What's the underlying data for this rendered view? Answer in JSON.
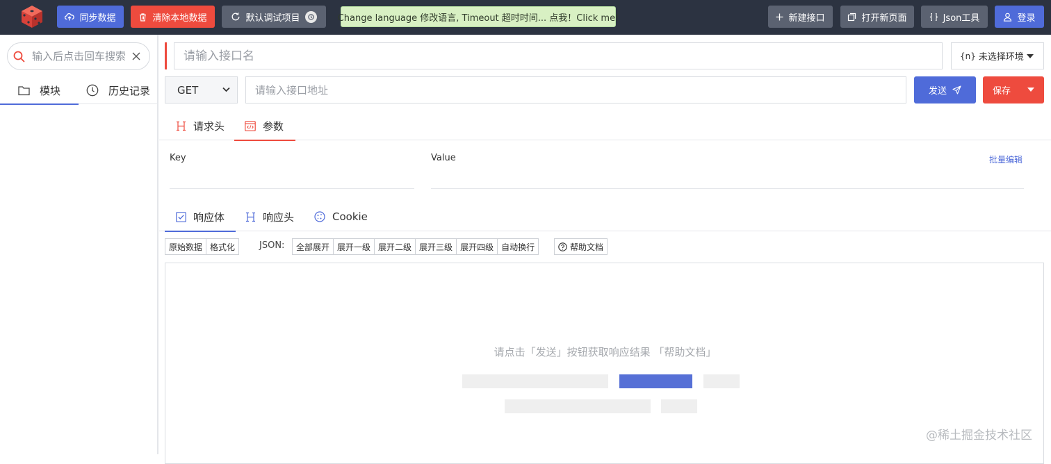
{
  "topbar": {
    "sync_label": "同步数据",
    "clear_label": "清除本地数据",
    "project_label": "默认调试项目",
    "notice": "Change language 修改语言, Timeout 超时时间... 点我！Click me!",
    "new_api_label": "新建接口",
    "open_page_label": "打开新页面",
    "json_tool_label": "Json工具",
    "login_label": "登录"
  },
  "sidebar": {
    "search_placeholder": "输入后点击回车搜索",
    "tabs": [
      {
        "label": "模块",
        "active": true
      },
      {
        "label": "历史记录",
        "active": false
      }
    ]
  },
  "request": {
    "name_placeholder": "请输入接口名",
    "env_label": "未选择环境",
    "env_icon_text": "{n}",
    "method": "GET",
    "url_placeholder": "请输入接口地址",
    "send_label": "发送",
    "save_label": "保存",
    "tabs": [
      {
        "label": "请求头",
        "active": false
      },
      {
        "label": "参数",
        "active": true
      }
    ],
    "params": {
      "key_header": "Key",
      "value_header": "Value",
      "batch_edit_label": "批量编辑"
    }
  },
  "response": {
    "tabs": [
      {
        "label": "响应体",
        "active": true
      },
      {
        "label": "响应头",
        "active": false
      },
      {
        "label": "Cookie",
        "active": false
      }
    ],
    "view_buttons": [
      "原始数据",
      "格式化"
    ],
    "json_label": "JSON:",
    "json_buttons": [
      "全部展开",
      "展开一级",
      "展开二级",
      "展开三级",
      "展开四级",
      "自动换行"
    ],
    "help_label": "帮助文档",
    "empty_message": "请点击「发送」按钮获取响应结果 「帮助文档」"
  },
  "watermark": "@稀土掘金技术社区",
  "colors": {
    "topbar_bg": "#2c3341",
    "primary_blue": "#4f6bd9",
    "danger_red": "#ee4b3e",
    "gray_button": "#5b6271",
    "notice_bg": "#d8f0c3"
  }
}
